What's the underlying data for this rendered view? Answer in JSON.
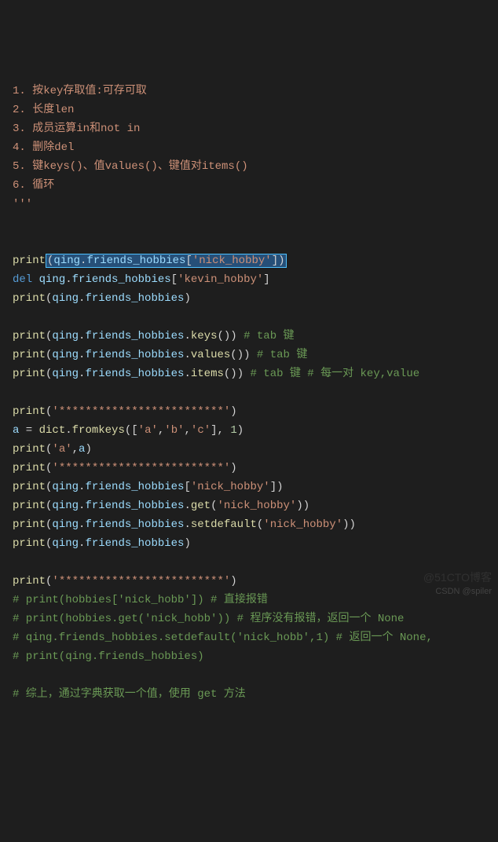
{
  "lines": [
    {
      "r": [
        {
          "c": "str",
          "t": "1. 按key存取值:可存可取"
        }
      ]
    },
    {
      "r": [
        {
          "c": "str",
          "t": "2. 长度len"
        }
      ]
    },
    {
      "r": [
        {
          "c": "str",
          "t": "3. 成员运算in和not in"
        }
      ]
    },
    {
      "r": [
        {
          "c": "str",
          "t": "4. 删除del"
        }
      ]
    },
    {
      "r": [
        {
          "c": "str",
          "t": "5. 键keys()、值values()、键值对items()"
        }
      ]
    },
    {
      "r": [
        {
          "c": "str",
          "t": "6. 循环"
        }
      ]
    },
    {
      "r": [
        {
          "c": "str",
          "t": "'''"
        }
      ]
    },
    {
      "r": [
        {
          "c": "",
          "t": ""
        }
      ]
    },
    {
      "r": [
        {
          "c": "",
          "t": ""
        }
      ]
    },
    {
      "r": [
        {
          "c": "fn",
          "t": "print"
        },
        {
          "c": "sel",
          "t": "(qing.friends_hobbies['nick_hobby'])",
          "inner": [
            {
              "c": "pun",
              "t": "("
            },
            {
              "c": "var",
              "t": "qing"
            },
            {
              "c": "pun",
              "t": "."
            },
            {
              "c": "attr",
              "t": "friends_hobbies"
            },
            {
              "c": "pun",
              "t": "["
            },
            {
              "c": "str",
              "t": "'nick_hobby'"
            },
            {
              "c": "pun",
              "t": "]"
            },
            {
              "c": "pun",
              "t": ")"
            }
          ]
        }
      ]
    },
    {
      "r": [
        {
          "c": "kw",
          "t": "del"
        },
        {
          "c": "pun",
          "t": " "
        },
        {
          "c": "var",
          "t": "qing"
        },
        {
          "c": "pun",
          "t": "."
        },
        {
          "c": "attr",
          "t": "friends_hobbies"
        },
        {
          "c": "pun",
          "t": "["
        },
        {
          "c": "str",
          "t": "'kevin_hobby'"
        },
        {
          "c": "pun",
          "t": "]"
        }
      ]
    },
    {
      "r": [
        {
          "c": "fn",
          "t": "print"
        },
        {
          "c": "pun",
          "t": "("
        },
        {
          "c": "var",
          "t": "qing"
        },
        {
          "c": "pun",
          "t": "."
        },
        {
          "c": "attr",
          "t": "friends_hobbies"
        },
        {
          "c": "pun",
          "t": ")"
        }
      ]
    },
    {
      "r": [
        {
          "c": "",
          "t": ""
        }
      ]
    },
    {
      "r": [
        {
          "c": "fn",
          "t": "print"
        },
        {
          "c": "pun",
          "t": "("
        },
        {
          "c": "var",
          "t": "qing"
        },
        {
          "c": "pun",
          "t": "."
        },
        {
          "c": "attr",
          "t": "friends_hobbies"
        },
        {
          "c": "pun",
          "t": "."
        },
        {
          "c": "fn",
          "t": "keys"
        },
        {
          "c": "pun",
          "t": "()) "
        },
        {
          "c": "com",
          "t": "# tab 键"
        }
      ]
    },
    {
      "r": [
        {
          "c": "fn",
          "t": "print"
        },
        {
          "c": "pun",
          "t": "("
        },
        {
          "c": "var",
          "t": "qing"
        },
        {
          "c": "pun",
          "t": "."
        },
        {
          "c": "attr",
          "t": "friends_hobbies"
        },
        {
          "c": "pun",
          "t": "."
        },
        {
          "c": "fn",
          "t": "values"
        },
        {
          "c": "pun",
          "t": "()) "
        },
        {
          "c": "com",
          "t": "# tab 键"
        }
      ]
    },
    {
      "r": [
        {
          "c": "fn",
          "t": "print"
        },
        {
          "c": "pun",
          "t": "("
        },
        {
          "c": "var",
          "t": "qing"
        },
        {
          "c": "pun",
          "t": "."
        },
        {
          "c": "attr",
          "t": "friends_hobbies"
        },
        {
          "c": "pun",
          "t": "."
        },
        {
          "c": "fn",
          "t": "items"
        },
        {
          "c": "pun",
          "t": "()) "
        },
        {
          "c": "com",
          "t": "# tab 键 # 每一对 key,value"
        }
      ]
    },
    {
      "r": [
        {
          "c": "",
          "t": ""
        }
      ]
    },
    {
      "r": [
        {
          "c": "fn",
          "t": "print"
        },
        {
          "c": "pun",
          "t": "("
        },
        {
          "c": "str",
          "t": "'*************************'"
        },
        {
          "c": "pun",
          "t": ")"
        }
      ]
    },
    {
      "r": [
        {
          "c": "var",
          "t": "a"
        },
        {
          "c": "pun",
          "t": " = "
        },
        {
          "c": "fn",
          "t": "dict"
        },
        {
          "c": "pun",
          "t": "."
        },
        {
          "c": "fn",
          "t": "fromkeys"
        },
        {
          "c": "pun",
          "t": "(["
        },
        {
          "c": "str",
          "t": "'a'"
        },
        {
          "c": "pun",
          "t": ","
        },
        {
          "c": "str",
          "t": "'b'"
        },
        {
          "c": "pun",
          "t": ","
        },
        {
          "c": "str",
          "t": "'c'"
        },
        {
          "c": "pun",
          "t": "], "
        },
        {
          "c": "num",
          "t": "1"
        },
        {
          "c": "pun",
          "t": ")"
        }
      ]
    },
    {
      "r": [
        {
          "c": "fn",
          "t": "print"
        },
        {
          "c": "pun",
          "t": "("
        },
        {
          "c": "str",
          "t": "'a'"
        },
        {
          "c": "pun",
          "t": ","
        },
        {
          "c": "var",
          "t": "a"
        },
        {
          "c": "pun",
          "t": ")"
        }
      ]
    },
    {
      "r": [
        {
          "c": "fn",
          "t": "print"
        },
        {
          "c": "pun",
          "t": "("
        },
        {
          "c": "str",
          "t": "'*************************'"
        },
        {
          "c": "pun",
          "t": ")"
        }
      ]
    },
    {
      "r": [
        {
          "c": "fn",
          "t": "print"
        },
        {
          "c": "pun",
          "t": "("
        },
        {
          "c": "var",
          "t": "qing"
        },
        {
          "c": "pun",
          "t": "."
        },
        {
          "c": "attr",
          "t": "friends_hobbies"
        },
        {
          "c": "pun",
          "t": "["
        },
        {
          "c": "str",
          "t": "'nick_hobby'"
        },
        {
          "c": "pun",
          "t": "])"
        }
      ]
    },
    {
      "r": [
        {
          "c": "fn",
          "t": "print"
        },
        {
          "c": "pun",
          "t": "("
        },
        {
          "c": "var",
          "t": "qing"
        },
        {
          "c": "pun",
          "t": "."
        },
        {
          "c": "attr",
          "t": "friends_hobbies"
        },
        {
          "c": "pun",
          "t": "."
        },
        {
          "c": "fn",
          "t": "get"
        },
        {
          "c": "pun",
          "t": "("
        },
        {
          "c": "str",
          "t": "'nick_hobby'"
        },
        {
          "c": "pun",
          "t": "))"
        }
      ]
    },
    {
      "r": [
        {
          "c": "fn",
          "t": "print"
        },
        {
          "c": "pun",
          "t": "("
        },
        {
          "c": "var",
          "t": "qing"
        },
        {
          "c": "pun",
          "t": "."
        },
        {
          "c": "attr",
          "t": "friends_hobbies"
        },
        {
          "c": "pun",
          "t": "."
        },
        {
          "c": "fn",
          "t": "setdefault"
        },
        {
          "c": "pun",
          "t": "("
        },
        {
          "c": "str",
          "t": "'nick_hobby'"
        },
        {
          "c": "pun",
          "t": "))"
        }
      ]
    },
    {
      "r": [
        {
          "c": "fn",
          "t": "print"
        },
        {
          "c": "pun",
          "t": "("
        },
        {
          "c": "var",
          "t": "qing"
        },
        {
          "c": "pun",
          "t": "."
        },
        {
          "c": "attr",
          "t": "friends_hobbies"
        },
        {
          "c": "pun",
          "t": ")"
        }
      ]
    },
    {
      "r": [
        {
          "c": "",
          "t": ""
        }
      ]
    },
    {
      "r": [
        {
          "c": "fn",
          "t": "print"
        },
        {
          "c": "pun",
          "t": "("
        },
        {
          "c": "str",
          "t": "'*************************'"
        },
        {
          "c": "pun",
          "t": ")"
        }
      ]
    },
    {
      "r": [
        {
          "c": "com",
          "t": "# print(hobbies['nick_hobb']) # 直接报错"
        }
      ]
    },
    {
      "r": [
        {
          "c": "com",
          "t": "# print(hobbies.get('nick_hobb')) # 程序没有报错，返回一个 None"
        }
      ]
    },
    {
      "r": [
        {
          "c": "com",
          "t": "# qing.friends_hobbies.setdefault('nick_hobb',1) # 返回一个 None,"
        }
      ]
    },
    {
      "r": [
        {
          "c": "com",
          "t": "# print(qing.friends_hobbies)"
        }
      ]
    },
    {
      "r": [
        {
          "c": "",
          "t": ""
        }
      ]
    },
    {
      "r": [
        {
          "c": "com",
          "t": "# 综上，通过字典获取一个值，使用 get 方法"
        }
      ]
    }
  ],
  "watermark1": "CSDN @spiler",
  "watermark2": "@51CTO博客"
}
